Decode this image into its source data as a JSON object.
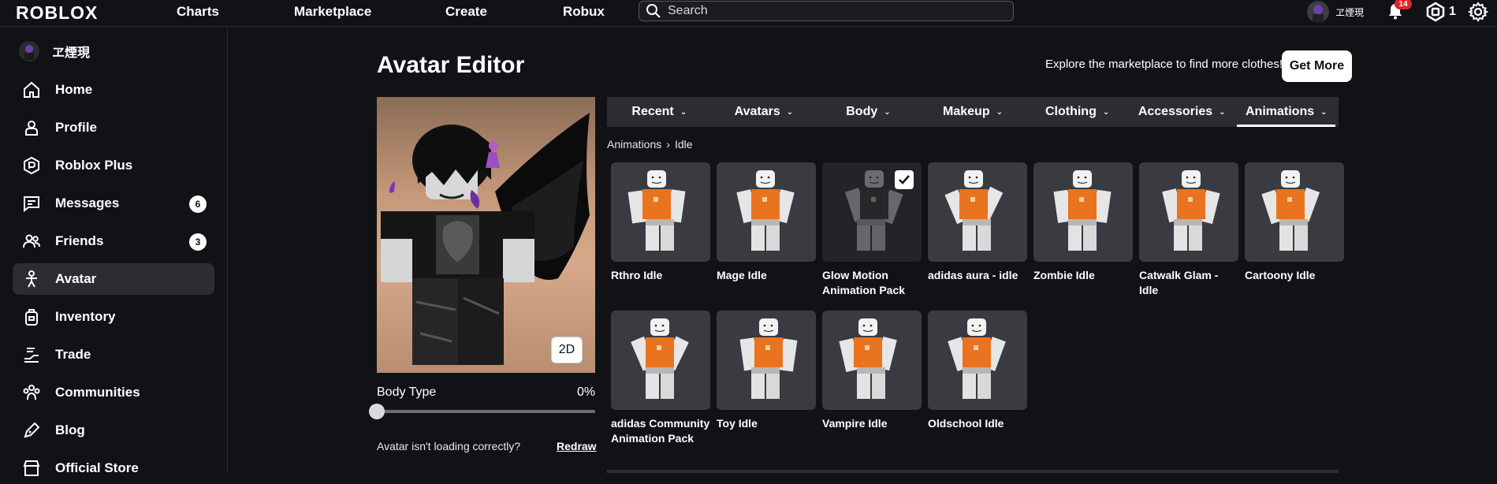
{
  "topbar": {
    "logo": "ROBLOX",
    "nav": [
      "Charts",
      "Marketplace",
      "Create",
      "Robux"
    ],
    "search_placeholder": "Search",
    "username": "ヱ煙現",
    "notification_count": "14",
    "robux_balance": "1"
  },
  "sidebar": {
    "username": "ヱ煙現",
    "items": [
      {
        "label": "Home",
        "icon": "home-icon"
      },
      {
        "label": "Profile",
        "icon": "profile-icon"
      },
      {
        "label": "Roblox Plus",
        "icon": "roblox-plus-icon"
      },
      {
        "label": "Messages",
        "icon": "messages-icon",
        "badge": "6"
      },
      {
        "label": "Friends",
        "icon": "friends-icon",
        "badge": "3"
      },
      {
        "label": "Avatar",
        "icon": "avatar-icon",
        "active": true
      },
      {
        "label": "Inventory",
        "icon": "inventory-icon"
      },
      {
        "label": "Trade",
        "icon": "trade-icon"
      },
      {
        "label": "Communities",
        "icon": "communities-icon"
      },
      {
        "label": "Blog",
        "icon": "blog-icon"
      },
      {
        "label": "Official Store",
        "icon": "store-icon"
      }
    ]
  },
  "main": {
    "title": "Avatar Editor",
    "explore_text": "Explore the marketplace to find more clothes!",
    "get_more_label": "Get More",
    "toggle_2d_label": "2D",
    "body_type_label": "Body Type",
    "body_type_value": "0%",
    "body_type_level": 0,
    "loading_text": "Avatar isn't loading correctly?",
    "redraw_label": "Redraw",
    "tabs": [
      "Recent",
      "Avatars",
      "Body",
      "Makeup",
      "Clothing",
      "Accessories",
      "Animations"
    ],
    "active_tab": "Animations",
    "breadcrumb": [
      "Animations",
      "Idle"
    ],
    "items": [
      {
        "name": "Rthro Idle"
      },
      {
        "name": "Mage Idle"
      },
      {
        "name": "Glow Motion Animation Pack",
        "selected": true
      },
      {
        "name": "adidas aura - idle"
      },
      {
        "name": "Zombie Idle"
      },
      {
        "name": "Catwalk Glam - Idle"
      },
      {
        "name": "Cartoony Idle"
      },
      {
        "name": "adidas Community Animation Pack"
      },
      {
        "name": "Toy Idle"
      },
      {
        "name": "Vampire Idle"
      },
      {
        "name": "Oldschool Idle"
      }
    ]
  },
  "colors": {
    "background": "#111216",
    "panel": "#2b2d33",
    "card": "#3a3b41",
    "notification_badge": "#e1242b",
    "avatar_shirt": "#e9731f"
  }
}
